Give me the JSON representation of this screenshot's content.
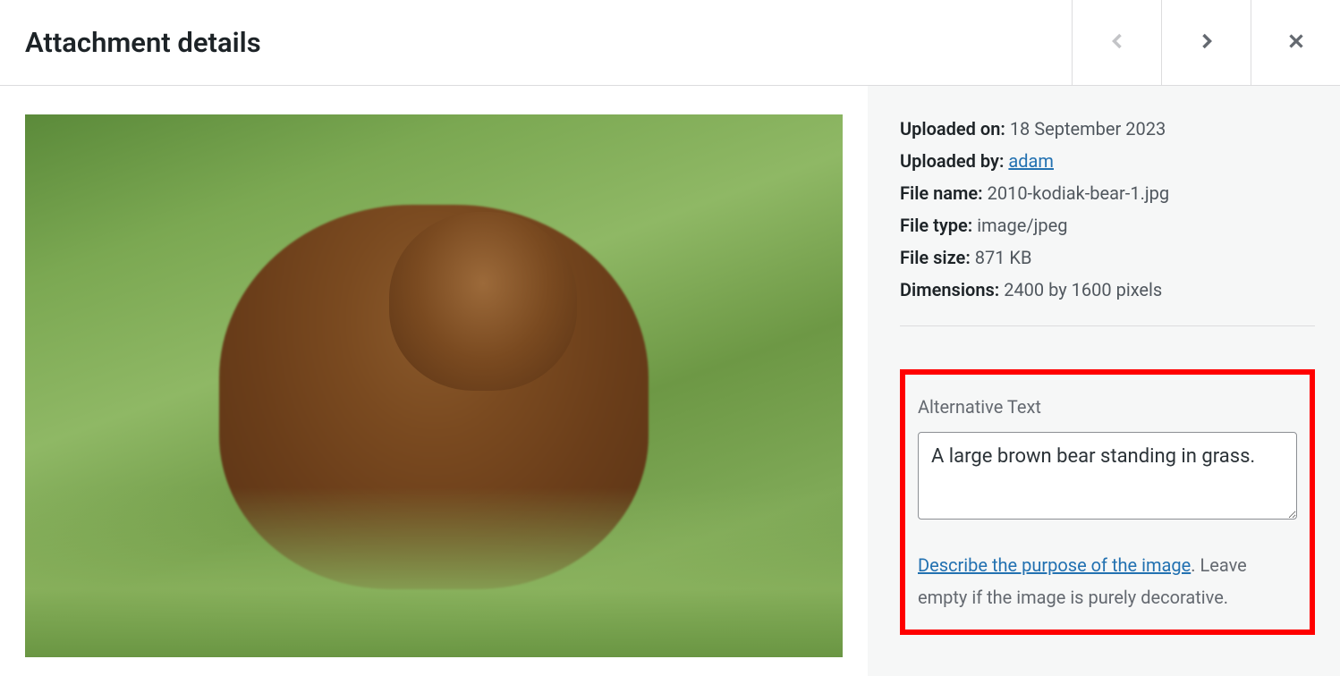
{
  "header": {
    "title": "Attachment details"
  },
  "meta": {
    "uploaded_on_label": "Uploaded on:",
    "uploaded_on_value": "18 September 2023",
    "uploaded_by_label": "Uploaded by:",
    "uploaded_by_value": "adam",
    "file_name_label": "File name:",
    "file_name_value": "2010-kodiak-bear-1.jpg",
    "file_type_label": "File type:",
    "file_type_value": "image/jpeg",
    "file_size_label": "File size:",
    "file_size_value": "871 KB",
    "dimensions_label": "Dimensions:",
    "dimensions_value": "2400 by 1600 pixels"
  },
  "alt": {
    "label": "Alternative Text",
    "value": "A large brown bear standing in grass.",
    "help_link": "Describe the purpose of the image",
    "help_period": ".",
    "help_rest": " Leave empty if the image is purely decorative."
  }
}
